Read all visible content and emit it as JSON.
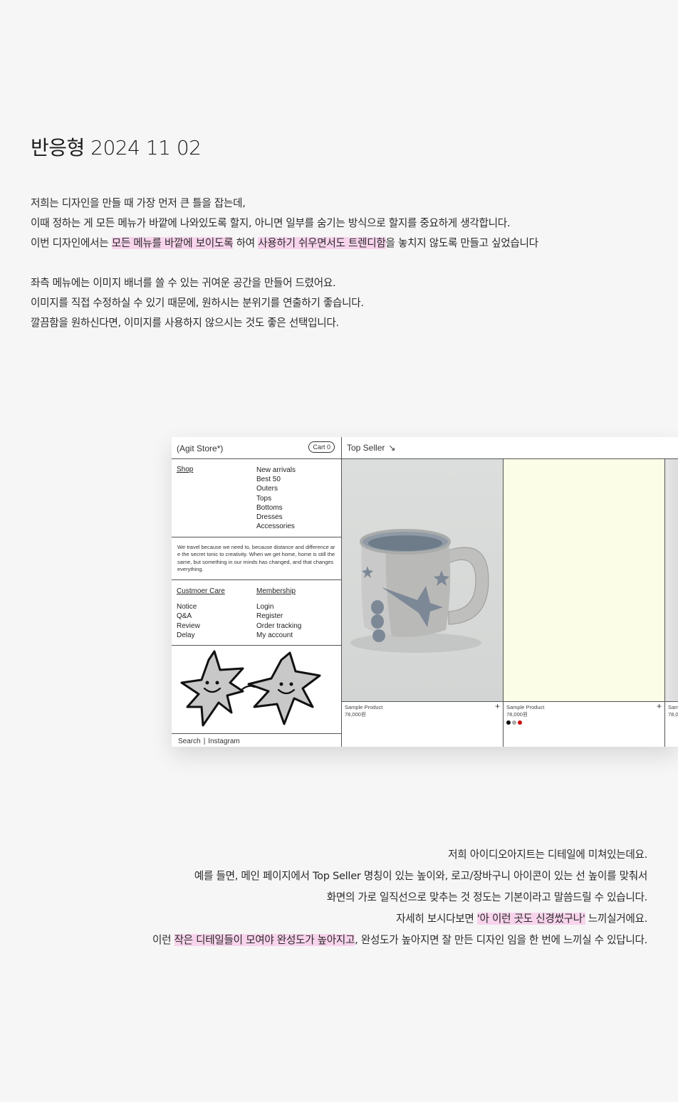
{
  "title": "반응형 2024 11 02",
  "intro1": {
    "line1": "저희는 디자인을 만들 때 가장 먼저 큰 틀을 잡는데,",
    "line2": "이때 정하는 게 모든 메뉴가 바깥에 나와있도록 할지, 아니면 일부를 숨기는 방식으로 할지를 중요하게 생각합니다.",
    "line3_a": "이번 디자인에서는 ",
    "line3_hl1": "모든 메뉴를 바깥에 보이도록",
    "line3_b": " 하여 ",
    "line3_hl2": "사용하기 쉬우면서도 트렌디함",
    "line3_c": "을 놓치지 않도록 만들고 싶었습니다"
  },
  "intro2": {
    "line1": "좌측 메뉴에는 이미지 배너를 쓸 수 있는 귀여운 공간을 만들어 드렸어요.",
    "line2": "이미지를 직접 수정하실 수 있기 때문에, 원하시는 분위기를 연출하기 좋습니다.",
    "line3": "깔끔함을 원하신다면, 이미지를 사용하지 않으시는 것도 좋은 선택입니다."
  },
  "mock": {
    "store_name": "(Agit Store*)",
    "cart": "Cart 0",
    "shop_heading": "Shop",
    "categories": [
      "New arrivals",
      "Best 50",
      "Outers",
      "Tops",
      "Bottoms",
      "Dresses",
      "Accessories"
    ],
    "quote": "We travel because we need to, because distance and difference are the secret tonic to creativity. When we get home, home is still the same, but something in our minds has changed, and that changes everything.",
    "care_heading": "Custmoer Care",
    "care_items": [
      "Notice",
      "Q&A",
      "Review",
      "Delay"
    ],
    "member_heading": "Membership",
    "member_items": [
      "Login",
      "Register",
      "Order tracking",
      "My account"
    ],
    "footer_search": "Search",
    "footer_sep": "|",
    "footer_instagram": "Instagram",
    "top_seller": "Top Seller",
    "top_seller_arrow": "↘",
    "products": [
      {
        "name": "Sample Product",
        "price": "78,000원",
        "plus": "+",
        "colors": []
      },
      {
        "name": "Sample Product",
        "price": "78,000원",
        "plus": "+",
        "colors": [
          "#111111",
          "#aaaaaa",
          "#cc1111"
        ]
      },
      {
        "name": "Sam",
        "price": "78,0"
      }
    ],
    "product_bg_2": "#fbfde6"
  },
  "outro": {
    "line1": "저희 아이디오아지트는 디테일에 미쳐있는데요.",
    "line2": "예를 들면, 메인 페이지에서 Top Seller 명칭이 있는 높이와, 로고/장바구니 아이콘이 있는 선 높이를 맞춰서",
    "line3": "화면의 가로 일직선으로 맞추는 것 정도는 기본이라고 말씀드릴 수 있습니다.",
    "line4_a": "자세히 보시다보면 ",
    "line4_hl": "'아 이런 곳도 신경썼구나'",
    "line4_b": " 느끼실거에요.",
    "line5_a": "이런 ",
    "line5_hl": "작은 디테일들이 모여야 완성도가 높아지고",
    "line5_b": ", 완성도가 높아지면 잘 만든 디자인 임을 한 번에 느끼실 수 있답니다."
  },
  "colors": {
    "highlight": "#f8d4ec",
    "background": "#f6f6f6"
  }
}
